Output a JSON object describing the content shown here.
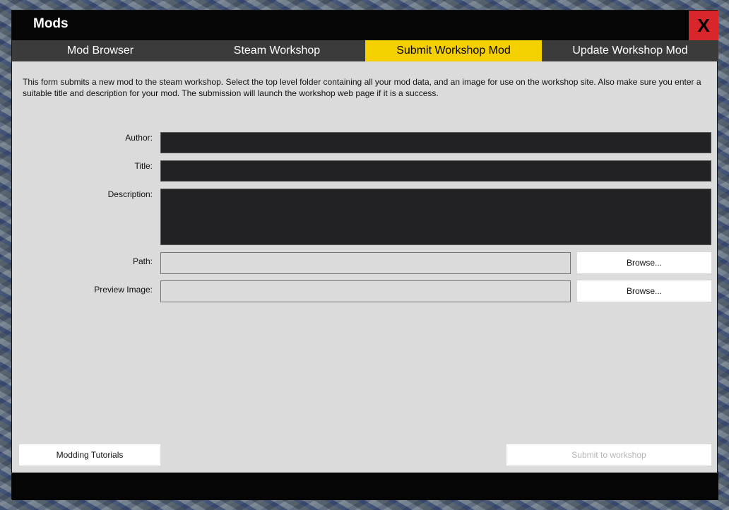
{
  "window": {
    "title": "Mods",
    "close_label": "X"
  },
  "tabs": [
    {
      "label": "Mod Browser",
      "active": false
    },
    {
      "label": "Steam Workshop",
      "active": false
    },
    {
      "label": "Submit Workshop Mod",
      "active": true
    },
    {
      "label": "Update Workshop Mod",
      "active": false
    }
  ],
  "form": {
    "intro": "This form submits a new mod to the steam workshop. Select the top level folder containing all your mod data, and an image for use on the workshop site. Also make sure you enter a suitable title and description for your mod. The submission will launch the workshop web page if it is a success.",
    "author_label": "Author:",
    "author_value": "",
    "title_label": "Title:",
    "title_value": "",
    "description_label": "Description:",
    "description_value": "",
    "path_label": "Path:",
    "path_value": "",
    "path_browse": "Browse...",
    "preview_label": "Preview Image:",
    "preview_value": "",
    "preview_browse": "Browse..."
  },
  "buttons": {
    "tutorials": "Modding Tutorials",
    "submit": "Submit to workshop"
  },
  "colors": {
    "active_tab": "#f5d000",
    "close_button": "#d8262b",
    "panel": "#dcdbdc",
    "dark_field": "#222124"
  }
}
